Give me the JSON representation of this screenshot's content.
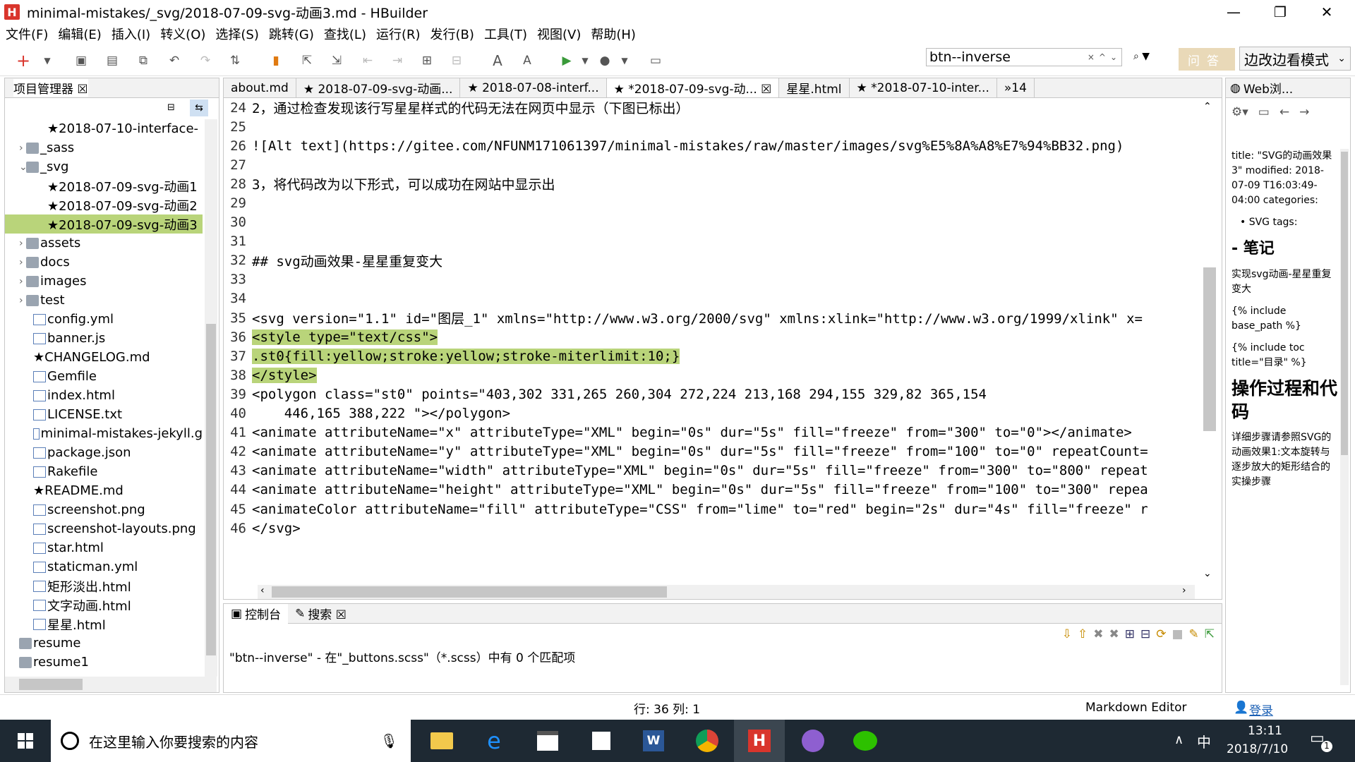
{
  "window": {
    "title": "minimal-mistakes/_svg/2018-07-09-svg-动画3.md - HBuilder",
    "min": "—",
    "max": "❐",
    "close": "✕"
  },
  "menu": [
    "文件(F)",
    "编辑(E)",
    "插入(I)",
    "转义(O)",
    "选择(S)",
    "跳转(G)",
    "查找(L)",
    "运行(R)",
    "发行(B)",
    "工具(T)",
    "视图(V)",
    "帮助(H)"
  ],
  "search": {
    "value": "btn--inverse",
    "clear": "×",
    "up": "^",
    "down": "⌄"
  },
  "ask_button": "问答",
  "mode_select": "边改边看模式",
  "project_panel": {
    "title": "项目管理器 ☒",
    "tree": [
      {
        "label": "★2018-07-10-interface-",
        "indent": 60
      },
      {
        "label": "_sass",
        "indent": 30
      },
      {
        "label": "_svg",
        "indent": 30
      },
      {
        "label": "★2018-07-09-svg-动画1",
        "indent": 60
      },
      {
        "label": "★2018-07-09-svg-动画2",
        "indent": 60
      },
      {
        "label": "★2018-07-09-svg-动画3",
        "indent": 60
      },
      {
        "label": "assets",
        "indent": 30
      },
      {
        "label": "docs",
        "indent": 30
      },
      {
        "label": "images",
        "indent": 30
      },
      {
        "label": "test",
        "indent": 30
      },
      {
        "label": "config.yml",
        "indent": 40
      },
      {
        "label": "banner.js",
        "indent": 40
      },
      {
        "label": "★CHANGELOG.md",
        "indent": 40
      },
      {
        "label": "Gemfile",
        "indent": 40
      },
      {
        "label": "index.html",
        "indent": 40
      },
      {
        "label": "LICENSE.txt",
        "indent": 40
      },
      {
        "label": "minimal-mistakes-jekyll.g",
        "indent": 40
      },
      {
        "label": "package.json",
        "indent": 40
      },
      {
        "label": "Rakefile",
        "indent": 40
      },
      {
        "label": "★README.md",
        "indent": 40
      },
      {
        "label": "screenshot.png",
        "indent": 40
      },
      {
        "label": "screenshot-layouts.png",
        "indent": 40
      },
      {
        "label": "star.html",
        "indent": 40
      },
      {
        "label": "staticman.yml",
        "indent": 40
      },
      {
        "label": "矩形淡出.html",
        "indent": 40
      },
      {
        "label": "文字动画.html",
        "indent": 40
      },
      {
        "label": "星星.html",
        "indent": 40
      },
      {
        "label": "resume",
        "indent": 20
      },
      {
        "label": "resume1",
        "indent": 20
      }
    ]
  },
  "editor_tabs": [
    "about.md",
    "★ 2018-07-09-svg-动画...",
    "★ 2018-07-08-interf...",
    "★ *2018-07-09-svg-动... ☒",
    "星星.html",
    "★ *2018-07-10-inter...",
    "»14"
  ],
  "code_lines": [
    {
      "n": "24",
      "t": "2，通过检查发现该行写星星样式的代码无法在网页中显示（下图已标出）"
    },
    {
      "n": "25",
      "t": ""
    },
    {
      "n": "26",
      "t": "![Alt text](https://gitee.com/NFUNM171061397/minimal-mistakes/raw/master/images/svg%E5%8A%A8%E7%94%BB32.png)"
    },
    {
      "n": "27",
      "t": ""
    },
    {
      "n": "28",
      "t": "3，将代码改为以下形式，可以成功在网站中显示出"
    },
    {
      "n": "29",
      "t": ""
    },
    {
      "n": "30",
      "t": ""
    },
    {
      "n": "31",
      "t": ""
    },
    {
      "n": "32",
      "t": "## svg动画效果-星星重复变大"
    },
    {
      "n": "33",
      "t": ""
    },
    {
      "n": "34",
      "t": ""
    },
    {
      "n": "35",
      "t": "<svg version=\"1.1\" id=\"图层_1\" xmlns=\"http://www.w3.org/2000/svg\" xmlns:xlink=\"http://www.w3.org/1999/xlink\" x="
    },
    {
      "n": "36",
      "t": "<style type=\"text/css\">"
    },
    {
      "n": "37",
      "t": ".st0{fill:yellow;stroke:yellow;stroke-miterlimit:10;}"
    },
    {
      "n": "38",
      "t": "</style>"
    },
    {
      "n": "39",
      "t": "<polygon class=\"st0\" points=\"403,302 331,265 260,304 272,224 213,168 294,155 329,82 365,154"
    },
    {
      "n": "40",
      "t": "    446,165 388,222 \"></polygon>"
    },
    {
      "n": "41",
      "t": "<animate attributeName=\"x\" attributeType=\"XML\" begin=\"0s\" dur=\"5s\" fill=\"freeze\" from=\"300\" to=\"0\"></animate>"
    },
    {
      "n": "42",
      "t": "<animate attributeName=\"y\" attributeType=\"XML\" begin=\"0s\" dur=\"5s\" fill=\"freeze\" from=\"100\" to=\"0\" repeatCount="
    },
    {
      "n": "43",
      "t": "<animate attributeName=\"width\" attributeType=\"XML\" begin=\"0s\" dur=\"5s\" fill=\"freeze\" from=\"300\" to=\"800\" repeat"
    },
    {
      "n": "44",
      "t": "<animate attributeName=\"height\" attributeType=\"XML\" begin=\"0s\" dur=\"5s\" fill=\"freeze\" from=\"100\" to=\"300\" repea"
    },
    {
      "n": "45",
      "t": "<animateColor attributeName=\"fill\" attributeType=\"CSS\" from=\"lime\" to=\"red\" begin=\"2s\" dur=\"4s\" fill=\"freeze\" r"
    },
    {
      "n": "46",
      "t": "</svg>"
    }
  ],
  "console": {
    "tab_console": "控制台",
    "tab_search": "搜索 ☒",
    "message": "\"btn--inverse\" - 在\"_buttons.scss\"（*.scss）中有 0 个匹配项"
  },
  "status": {
    "position": "行: 36 列: 1",
    "editor_type": "Markdown Editor",
    "login": "登录"
  },
  "web_panel": {
    "title": "Web浏...",
    "paragraphs": [
      "title: \"SVG的动画效果3\" modified: 2018-07-09 T16:03:49-04:00 categories:",
      "• SVG tags:",
      "- 笔记",
      "实现svg动画-星星重复变大",
      "{% include base_path %}",
      "{% include toc title=\"目录\" %}",
      "操作过程和代码",
      "详细步骤请参照SVG的动画效果1:文本旋转与逐步放大的矩形结合的实操步骤"
    ]
  },
  "taskbar": {
    "search_placeholder": "在这里输入你要搜索的内容",
    "ime": "中",
    "time": "13:11",
    "date": "2018/7/10",
    "notify_count": "1"
  },
  "colors": {
    "highlight": "#b9d47a",
    "taskbar": "#1e2933",
    "brand": "#d9352c"
  }
}
